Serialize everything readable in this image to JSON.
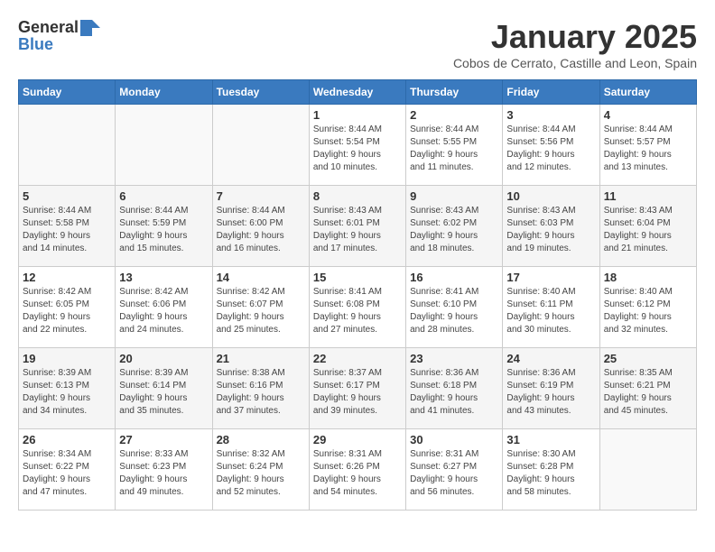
{
  "logo": {
    "general": "General",
    "blue": "Blue"
  },
  "title": "January 2025",
  "subtitle": "Cobos de Cerrato, Castille and Leon, Spain",
  "days_of_week": [
    "Sunday",
    "Monday",
    "Tuesday",
    "Wednesday",
    "Thursday",
    "Friday",
    "Saturday"
  ],
  "weeks": [
    [
      {
        "day": "",
        "info": ""
      },
      {
        "day": "",
        "info": ""
      },
      {
        "day": "",
        "info": ""
      },
      {
        "day": "1",
        "info": "Sunrise: 8:44 AM\nSunset: 5:54 PM\nDaylight: 9 hours\nand 10 minutes."
      },
      {
        "day": "2",
        "info": "Sunrise: 8:44 AM\nSunset: 5:55 PM\nDaylight: 9 hours\nand 11 minutes."
      },
      {
        "day": "3",
        "info": "Sunrise: 8:44 AM\nSunset: 5:56 PM\nDaylight: 9 hours\nand 12 minutes."
      },
      {
        "day": "4",
        "info": "Sunrise: 8:44 AM\nSunset: 5:57 PM\nDaylight: 9 hours\nand 13 minutes."
      }
    ],
    [
      {
        "day": "5",
        "info": "Sunrise: 8:44 AM\nSunset: 5:58 PM\nDaylight: 9 hours\nand 14 minutes."
      },
      {
        "day": "6",
        "info": "Sunrise: 8:44 AM\nSunset: 5:59 PM\nDaylight: 9 hours\nand 15 minutes."
      },
      {
        "day": "7",
        "info": "Sunrise: 8:44 AM\nSunset: 6:00 PM\nDaylight: 9 hours\nand 16 minutes."
      },
      {
        "day": "8",
        "info": "Sunrise: 8:43 AM\nSunset: 6:01 PM\nDaylight: 9 hours\nand 17 minutes."
      },
      {
        "day": "9",
        "info": "Sunrise: 8:43 AM\nSunset: 6:02 PM\nDaylight: 9 hours\nand 18 minutes."
      },
      {
        "day": "10",
        "info": "Sunrise: 8:43 AM\nSunset: 6:03 PM\nDaylight: 9 hours\nand 19 minutes."
      },
      {
        "day": "11",
        "info": "Sunrise: 8:43 AM\nSunset: 6:04 PM\nDaylight: 9 hours\nand 21 minutes."
      }
    ],
    [
      {
        "day": "12",
        "info": "Sunrise: 8:42 AM\nSunset: 6:05 PM\nDaylight: 9 hours\nand 22 minutes."
      },
      {
        "day": "13",
        "info": "Sunrise: 8:42 AM\nSunset: 6:06 PM\nDaylight: 9 hours\nand 24 minutes."
      },
      {
        "day": "14",
        "info": "Sunrise: 8:42 AM\nSunset: 6:07 PM\nDaylight: 9 hours\nand 25 minutes."
      },
      {
        "day": "15",
        "info": "Sunrise: 8:41 AM\nSunset: 6:08 PM\nDaylight: 9 hours\nand 27 minutes."
      },
      {
        "day": "16",
        "info": "Sunrise: 8:41 AM\nSunset: 6:10 PM\nDaylight: 9 hours\nand 28 minutes."
      },
      {
        "day": "17",
        "info": "Sunrise: 8:40 AM\nSunset: 6:11 PM\nDaylight: 9 hours\nand 30 minutes."
      },
      {
        "day": "18",
        "info": "Sunrise: 8:40 AM\nSunset: 6:12 PM\nDaylight: 9 hours\nand 32 minutes."
      }
    ],
    [
      {
        "day": "19",
        "info": "Sunrise: 8:39 AM\nSunset: 6:13 PM\nDaylight: 9 hours\nand 34 minutes."
      },
      {
        "day": "20",
        "info": "Sunrise: 8:39 AM\nSunset: 6:14 PM\nDaylight: 9 hours\nand 35 minutes."
      },
      {
        "day": "21",
        "info": "Sunrise: 8:38 AM\nSunset: 6:16 PM\nDaylight: 9 hours\nand 37 minutes."
      },
      {
        "day": "22",
        "info": "Sunrise: 8:37 AM\nSunset: 6:17 PM\nDaylight: 9 hours\nand 39 minutes."
      },
      {
        "day": "23",
        "info": "Sunrise: 8:36 AM\nSunset: 6:18 PM\nDaylight: 9 hours\nand 41 minutes."
      },
      {
        "day": "24",
        "info": "Sunrise: 8:36 AM\nSunset: 6:19 PM\nDaylight: 9 hours\nand 43 minutes."
      },
      {
        "day": "25",
        "info": "Sunrise: 8:35 AM\nSunset: 6:21 PM\nDaylight: 9 hours\nand 45 minutes."
      }
    ],
    [
      {
        "day": "26",
        "info": "Sunrise: 8:34 AM\nSunset: 6:22 PM\nDaylight: 9 hours\nand 47 minutes."
      },
      {
        "day": "27",
        "info": "Sunrise: 8:33 AM\nSunset: 6:23 PM\nDaylight: 9 hours\nand 49 minutes."
      },
      {
        "day": "28",
        "info": "Sunrise: 8:32 AM\nSunset: 6:24 PM\nDaylight: 9 hours\nand 52 minutes."
      },
      {
        "day": "29",
        "info": "Sunrise: 8:31 AM\nSunset: 6:26 PM\nDaylight: 9 hours\nand 54 minutes."
      },
      {
        "day": "30",
        "info": "Sunrise: 8:31 AM\nSunset: 6:27 PM\nDaylight: 9 hours\nand 56 minutes."
      },
      {
        "day": "31",
        "info": "Sunrise: 8:30 AM\nSunset: 6:28 PM\nDaylight: 9 hours\nand 58 minutes."
      },
      {
        "day": "",
        "info": ""
      }
    ]
  ]
}
